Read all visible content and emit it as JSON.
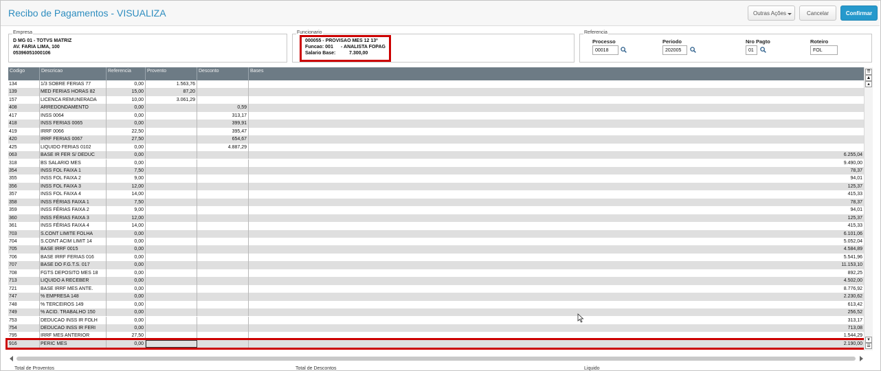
{
  "window": {
    "title": "Recibo de Pagamentos - VISUALIZA",
    "buttons": {
      "outras": "Outras Ações",
      "cancelar": "Cancelar",
      "confirmar": "Confirmar"
    }
  },
  "empresa": {
    "legend": "Empresa",
    "line1": "D MG 01  - TOTVS MATRIZ",
    "line2": "AV. FARIA  LIMA, 100",
    "line3": "05396051000106"
  },
  "funcionario": {
    "legend": "Funcionario",
    "line1": "000055 - PROVISAO MES 12 13º",
    "funcao_label": "Funcao: 001",
    "funcao_value": "- ANALISTA FOPAG",
    "salario_label": "Salario Base:",
    "salario_value": "7.300,00"
  },
  "referencia": {
    "legend": "Referencia",
    "processo_label": "Processo",
    "processo_value": "00018",
    "periodo_label": "Periodo",
    "periodo_value": "202005",
    "nro_pagto_label": "Nro Pagto",
    "nro_pagto_value": "01",
    "roteiro_label": "Roteiro",
    "roteiro_value": "FOL"
  },
  "grid": {
    "headers": [
      "Codigo",
      "Descricao",
      "Referencia",
      "Provento",
      "Desconto",
      "Bases"
    ],
    "rows": [
      [
        "134",
        "1/3 SOBRE FERIAS 77",
        "0,00",
        "1.563,76",
        "",
        ""
      ],
      [
        "139",
        "MED FERIAS HORAS 82",
        "15,00",
        "87,20",
        "",
        ""
      ],
      [
        "157",
        "LICENCA REMUNERADA",
        "10,00",
        "3.061,29",
        "",
        ""
      ],
      [
        "408",
        "ARREDONDAMENTO",
        "0,00",
        "",
        "0,59",
        ""
      ],
      [
        "417",
        "INSS 0064",
        "0,00",
        "",
        "313,17",
        ""
      ],
      [
        "418",
        "INSS FERIAS 0065",
        "0,00",
        "",
        "399,91",
        ""
      ],
      [
        "419",
        "IRRF 0066",
        "22,50",
        "",
        "395,47",
        ""
      ],
      [
        "420",
        "IRRF FERIAS 0067",
        "27,50",
        "",
        "654,67",
        ""
      ],
      [
        "425",
        "LIQUIDO FERIAS 0102",
        "0,00",
        "",
        "4.887,29",
        ""
      ],
      [
        "063",
        "BASE IR FER S/ DEDUC",
        "0,00",
        "",
        "",
        "6.255,04"
      ],
      [
        "318",
        "BS SALARIO MES",
        "0,00",
        "",
        "",
        "9.490,00"
      ],
      [
        "354",
        "INSS FOL FAIXA 1",
        "7,50",
        "",
        "",
        "78,37"
      ],
      [
        "355",
        "INSS FOL FAIXA 2",
        "9,00",
        "",
        "",
        "94,01"
      ],
      [
        "356",
        "INSS FOL FAIXA 3",
        "12,00",
        "",
        "",
        "125,37"
      ],
      [
        "357",
        "INSS FOL FAIXA 4",
        "14,00",
        "",
        "",
        "415,33"
      ],
      [
        "358",
        "INSS FÉRIAS FAIXA 1",
        "7,50",
        "",
        "",
        "78,37"
      ],
      [
        "359",
        "INSS FÉRIAS FAIXA 2",
        "9,00",
        "",
        "",
        "94,01"
      ],
      [
        "360",
        "INSS FÉRIAS FAIXA 3",
        "12,00",
        "",
        "",
        "125,37"
      ],
      [
        "361",
        "INSS FÉRIAS FAIXA 4",
        "14,00",
        "",
        "",
        "415,33"
      ],
      [
        "703",
        "S.CONT LIMITE FOLHA",
        "0,00",
        "",
        "",
        "6.101,06"
      ],
      [
        "704",
        "S.CONT ACIM LIMIT 14",
        "0,00",
        "",
        "",
        "5.052,04"
      ],
      [
        "705",
        "BASE IRRF 0015",
        "0,00",
        "",
        "",
        "4.584,89"
      ],
      [
        "706",
        "BASE IRRF FERIAS 016",
        "0,00",
        "",
        "",
        "5.541,96"
      ],
      [
        "707",
        "BASE DO F.G.T.S. 017",
        "0,00",
        "",
        "",
        "11.153,10"
      ],
      [
        "708",
        "FGTS DEPOSITO MES 18",
        "0,00",
        "",
        "",
        "892,25"
      ],
      [
        "713",
        "LIQUIDO A RECEBER",
        "0,00",
        "",
        "",
        "4.502,00"
      ],
      [
        "721",
        "BASE IRRF MES ANTE.",
        "0,00",
        "",
        "",
        "8.776,92"
      ],
      [
        "747",
        "% EMPRESA  148",
        "0,00",
        "",
        "",
        "2.230,62"
      ],
      [
        "748",
        "% TERCEIROS 149",
        "0,00",
        "",
        "",
        "613,42"
      ],
      [
        "749",
        "% ACID. TRABALHO 150",
        "0,00",
        "",
        "",
        "256,52"
      ],
      [
        "753",
        "DEDUCAO INSS IR FOLH",
        "0,00",
        "",
        "",
        "313,17"
      ],
      [
        "754",
        "DEDUCAO INSS IR FERI",
        "0,00",
        "",
        "",
        "713,08"
      ],
      [
        "795",
        "IRRF MES ANTERIOR",
        "27,50",
        "",
        "",
        "1.544,29"
      ],
      [
        "916",
        "PERIC MES",
        "0,00",
        "",
        "",
        "2.190,00"
      ]
    ]
  },
  "totals": {
    "proventos": "Total de Proventos",
    "descontos": "Total de Descontos",
    "liquido": "Liquido"
  },
  "colors": {
    "accent": "#2699cc",
    "highlight": "#cc0000",
    "header_bg": "#6d7b85"
  }
}
